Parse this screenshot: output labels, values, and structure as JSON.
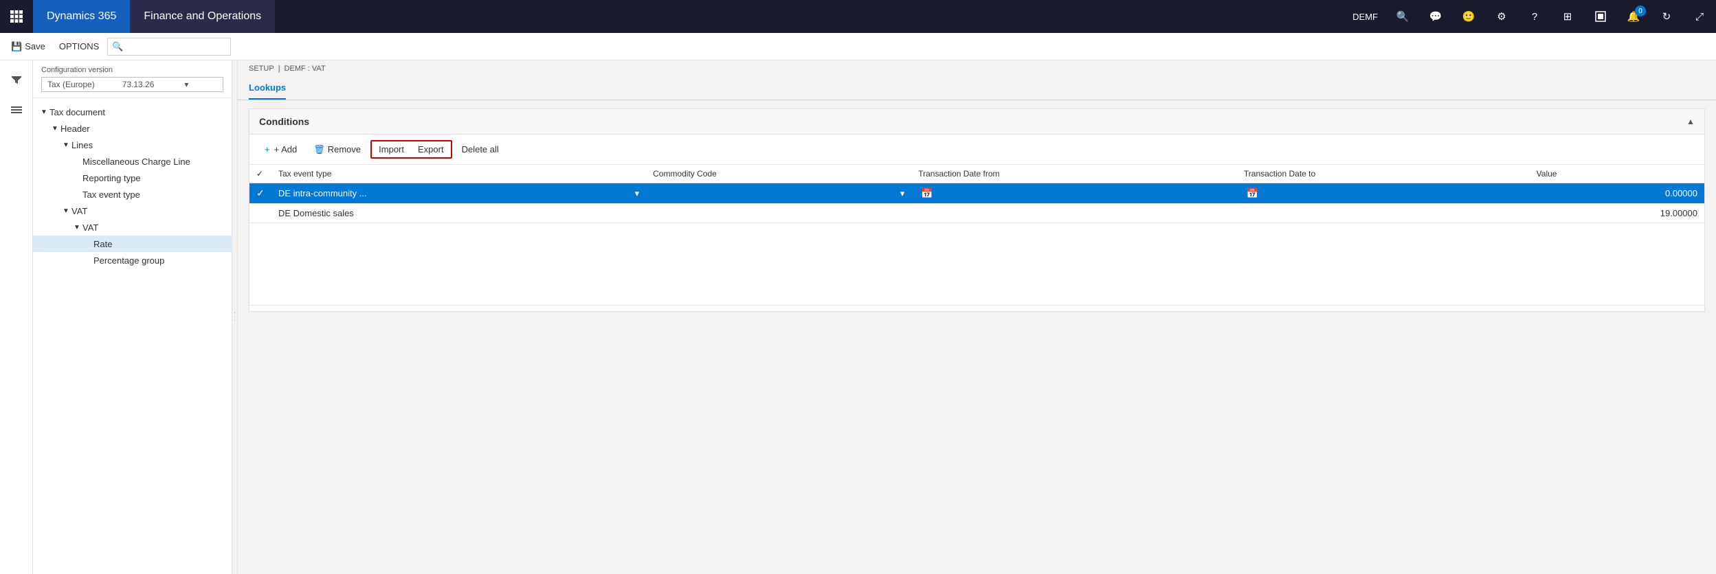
{
  "topNav": {
    "waffle": "⊞",
    "d365": "Dynamics 365",
    "app": "Finance and Operations",
    "company": "DEMF",
    "icons": {
      "search": "🔍",
      "chat": "💬",
      "user": "😊",
      "settings": "⚙",
      "help": "?"
    },
    "notificationCount": "0"
  },
  "toolbar": {
    "saveLabel": "Save",
    "optionsLabel": "OPTIONS"
  },
  "sidebar": {
    "configLabel": "Configuration version",
    "configName": "Tax (Europe)",
    "configVersion": "73.13.26",
    "treeItems": [
      {
        "id": "tax-document",
        "label": "Tax document",
        "indent": "indent-1",
        "toggle": "▼",
        "level": 1
      },
      {
        "id": "header",
        "label": "Header",
        "indent": "indent-2",
        "toggle": "▼",
        "level": 2
      },
      {
        "id": "lines",
        "label": "Lines",
        "indent": "indent-3",
        "toggle": "▼",
        "level": 3
      },
      {
        "id": "misc-charge-line",
        "label": "Miscellaneous Charge Line",
        "indent": "indent-4",
        "toggle": "",
        "level": 4
      },
      {
        "id": "reporting-type",
        "label": "Reporting type",
        "indent": "indent-4",
        "toggle": "",
        "level": 4
      },
      {
        "id": "tax-event-type",
        "label": "Tax event type",
        "indent": "indent-4",
        "toggle": "",
        "level": 4
      },
      {
        "id": "vat-parent",
        "label": "VAT",
        "indent": "indent-3",
        "toggle": "▼",
        "level": 3
      },
      {
        "id": "vat-child",
        "label": "VAT",
        "indent": "indent-4",
        "toggle": "▼",
        "level": 4
      },
      {
        "id": "rate",
        "label": "Rate",
        "indent": "indent-5",
        "toggle": "",
        "level": 5,
        "selected": true
      },
      {
        "id": "percentage-group",
        "label": "Percentage group",
        "indent": "indent-5",
        "toggle": "",
        "level": 5
      }
    ]
  },
  "breadcrumb": {
    "setup": "SETUP",
    "sep": "|",
    "path": "DEMF : VAT"
  },
  "tabs": [
    {
      "id": "lookups",
      "label": "Lookups",
      "active": true
    }
  ],
  "conditions": {
    "sectionTitle": "Conditions",
    "addLabel": "+ Add",
    "removeLabel": "Remove",
    "importLabel": "Import",
    "exportLabel": "Export",
    "deleteAllLabel": "Delete all",
    "columns": [
      {
        "id": "check",
        "label": "✓"
      },
      {
        "id": "tax-event-type",
        "label": "Tax event type"
      },
      {
        "id": "commodity-code",
        "label": "Commodity Code"
      },
      {
        "id": "transaction-date-from",
        "label": "Transaction Date from"
      },
      {
        "id": "transaction-date-to",
        "label": "Transaction Date to"
      },
      {
        "id": "value",
        "label": "Value"
      }
    ],
    "rows": [
      {
        "selected": true,
        "taxEventType": "DE intra-community ...",
        "commodityCode": "",
        "transDateFrom": "",
        "transDateTo": "",
        "value": "0.00000"
      },
      {
        "selected": false,
        "taxEventType": "DE Domestic sales",
        "commodityCode": "",
        "transDateFrom": "",
        "transDateTo": "",
        "value": "19.00000"
      }
    ]
  }
}
